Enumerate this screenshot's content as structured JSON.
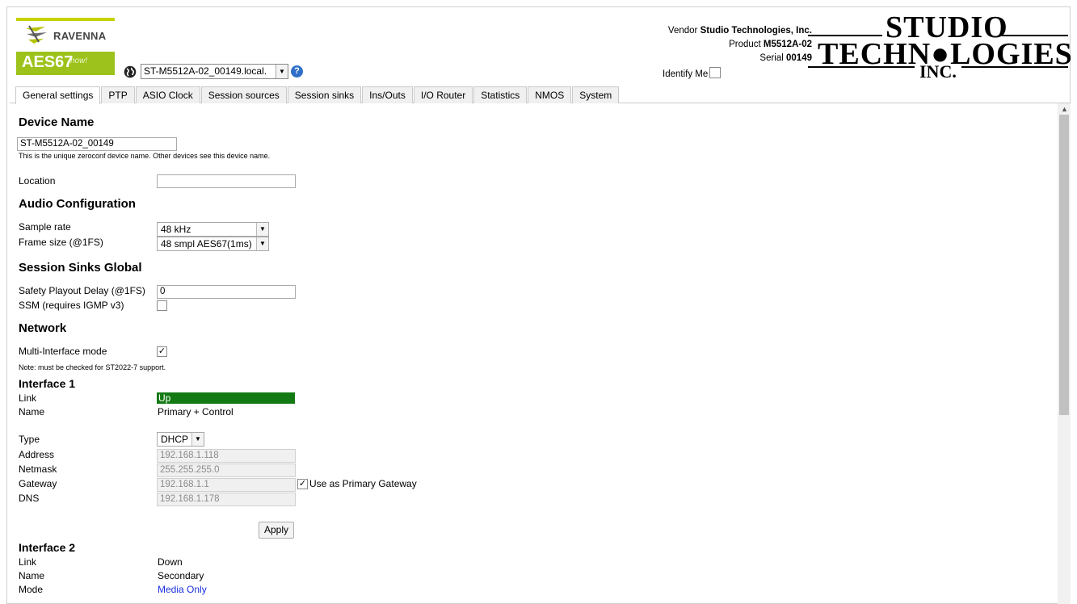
{
  "header": {
    "logo_ravenna": "RAVENNA",
    "logo_aes67": "AES67",
    "logo_now": "now!",
    "device_select_value": "ST-M5512A-02_00149.local.",
    "help_glyph": "?",
    "vendor_label": "Vendor",
    "vendor_value": "Studio Technologies, Inc.",
    "product_label": "Product",
    "product_value": "M5512A-02",
    "serial_label": "Serial",
    "serial_value": "00149",
    "identify_label": "Identify Me",
    "brand_line1": "STUDIO",
    "brand_line2": "TECHN●LOGIES",
    "brand_line3": "INC."
  },
  "tabs": [
    {
      "label": "General settings",
      "active": true
    },
    {
      "label": "PTP"
    },
    {
      "label": "ASIO Clock"
    },
    {
      "label": "Session sources"
    },
    {
      "label": "Session sinks"
    },
    {
      "label": "Ins/Outs"
    },
    {
      "label": "I/O Router"
    },
    {
      "label": "Statistics"
    },
    {
      "label": "NMOS"
    },
    {
      "label": "System"
    }
  ],
  "device_name": {
    "heading": "Device Name",
    "value": "ST-M5512A-02_00149",
    "note": "This is the unique zeroconf device name. Other devices see this device name.",
    "location_label": "Location",
    "location_value": ""
  },
  "audio": {
    "heading": "Audio Configuration",
    "sample_rate_label": "Sample rate",
    "sample_rate_value": "48 kHz",
    "frame_size_label": "Frame size (@1FS)",
    "frame_size_value": "48 smpl AES67(1ms)"
  },
  "sinks": {
    "heading": "Session Sinks Global",
    "delay_label": "Safety Playout Delay (@1FS)",
    "delay_value": "0",
    "ssm_label": "SSM (requires IGMP v3)",
    "ssm_checked": false
  },
  "network": {
    "heading": "Network",
    "multi_label": "Multi-Interface mode",
    "multi_checked": true,
    "note": "Note: must be checked for ST2022-7 support.",
    "interface1": {
      "heading": "Interface 1",
      "link_label": "Link",
      "link_value": "Up",
      "name_label": "Name",
      "name_value": "Primary + Control",
      "type_label": "Type",
      "type_value": "DHCP",
      "address_label": "Address",
      "address_value": "192.168.1.118",
      "netmask_label": "Netmask",
      "netmask_value": "255.255.255.0",
      "gateway_label": "Gateway",
      "gateway_value": "192.168.1.1",
      "primary_gw_label": "Use as Primary Gateway",
      "primary_gw_checked": true,
      "dns_label": "DNS",
      "dns_value": "192.168.1.178",
      "apply_label": "Apply"
    },
    "interface2": {
      "heading": "Interface 2",
      "link_label": "Link",
      "link_value": "Down",
      "name_label": "Name",
      "name_value": "Secondary",
      "mode_label": "Mode",
      "mode_value": "Media Only"
    }
  },
  "colors": {
    "link_up": "#137a13",
    "aes67_green": "#9dc21b",
    "help_blue": "#2f6fc8",
    "mode_blue": "#1a2fe0"
  },
  "icons": {
    "globe": "globe-icon",
    "help": "help-icon",
    "dropdown": "chevron-down-icon",
    "check": "check-icon"
  }
}
